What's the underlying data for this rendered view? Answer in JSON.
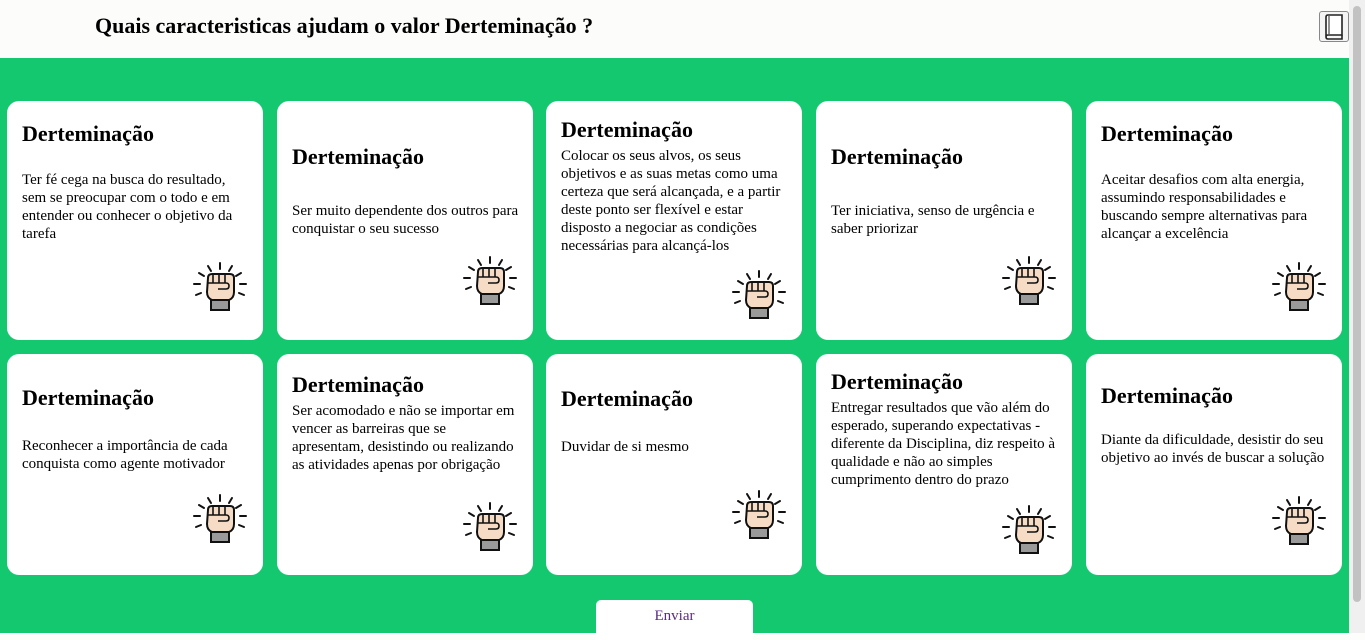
{
  "header": {
    "title": "Quais caracteristicas ajudam o valor Derteminação ?",
    "book_icon": "book-icon"
  },
  "cards": [
    {
      "title": "Derteminação",
      "text": "Ter fé cega na busca do resultado, sem se preocupar com o todo e em entender ou conhecer o objetivo da tarefa",
      "icon": "raised-fist-icon"
    },
    {
      "title": "Derteminação",
      "text": "Ser muito dependente dos outros para conquistar o seu sucesso",
      "icon": "raised-fist-icon"
    },
    {
      "title": "Derteminação",
      "text": "Colocar os seus alvos, os seus objetivos e as suas metas como uma certeza que será alcançada, e a partir deste ponto ser flexível e estar disposto a negociar as condições necessárias para alcançá-los",
      "icon": "raised-fist-icon"
    },
    {
      "title": "Derteminação",
      "text": "Ter iniciativa, senso de urgência e saber priorizar",
      "icon": "raised-fist-icon"
    },
    {
      "title": "Derteminação",
      "text": "Aceitar desafios com alta energia, assumindo responsabilidades e buscando sempre alternativas para alcançar a excelência",
      "icon": "raised-fist-icon"
    },
    {
      "title": "Derteminação",
      "text": "Reconhecer a importância de cada conquista como agente motivador",
      "icon": "raised-fist-icon"
    },
    {
      "title": "Derteminação",
      "text": "Ser acomodado e não se importar em vencer as barreiras que se apresentam, desistindo ou realizando as atividades apenas por obrigação",
      "icon": "raised-fist-icon"
    },
    {
      "title": "Derteminação",
      "text": "Duvidar de si mesmo",
      "icon": "raised-fist-icon"
    },
    {
      "title": "Derteminação",
      "text": "Entregar resultados que vão além do esperado, superando expectativas - diferente da Disciplina, diz respeito à qualidade e não ao simples cumprimento dentro do prazo",
      "icon": "raised-fist-icon"
    },
    {
      "title": "Derteminação",
      "text": "Diante da dificuldade, desistir do seu objetivo ao invés de buscar a solução",
      "icon": "raised-fist-icon"
    }
  ],
  "footer": {
    "submit_label": "Enviar"
  },
  "colors": {
    "background": "#13c86f",
    "card": "#ffffff",
    "button_text": "#5b2a86"
  }
}
